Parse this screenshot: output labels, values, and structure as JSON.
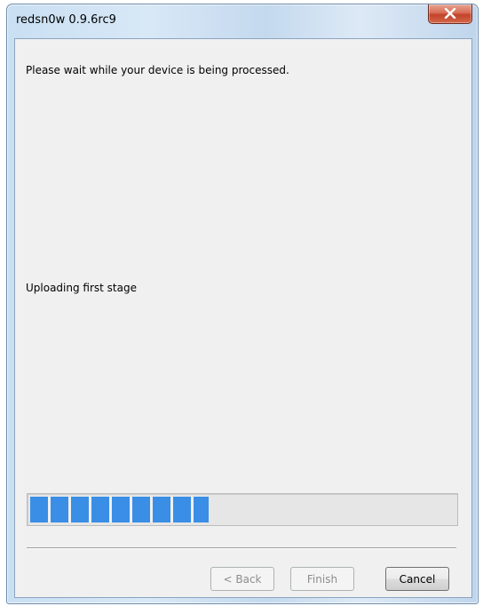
{
  "window": {
    "title": "redsn0w 0.9.6rc9"
  },
  "main": {
    "message": "Please wait while your device is being processed.",
    "status": "Uploading first stage",
    "progress_fraction": 0.42
  },
  "buttons": {
    "back_label": "< Back",
    "finish_label": "Finish",
    "cancel_label": "Cancel"
  },
  "icons": {
    "close": "close-icon"
  },
  "colors": {
    "progress_fill": "#3a8ee6",
    "dialog_background": "#f0f0f0",
    "close_button": "#c2432b"
  }
}
